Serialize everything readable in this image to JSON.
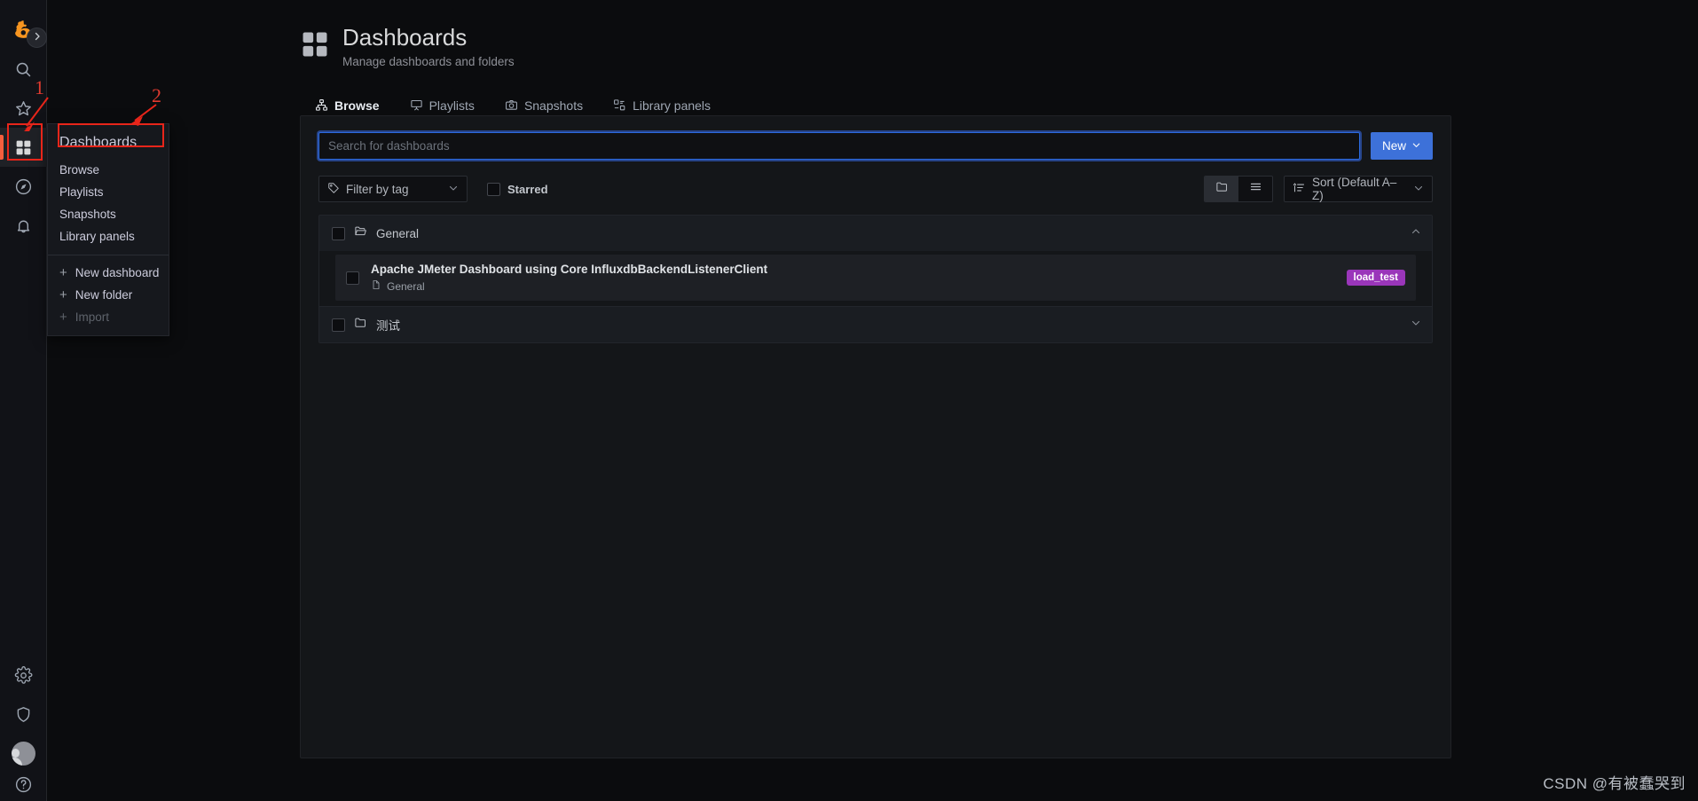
{
  "nav_rail": {
    "expand_button": {
      "icon": "chevron-right-icon"
    },
    "top_items": [
      {
        "name": "grafana-logo",
        "icon": "grafana-logo-icon",
        "label": "Grafana"
      },
      {
        "name": "search",
        "icon": "search-icon",
        "label": "Search"
      },
      {
        "name": "starred",
        "icon": "star-icon",
        "label": "Starred"
      },
      {
        "name": "dashboards",
        "icon": "apps-grid-icon",
        "label": "Dashboards",
        "active": true
      },
      {
        "name": "explore",
        "icon": "compass-icon",
        "label": "Explore"
      },
      {
        "name": "alerting",
        "icon": "bell-icon",
        "label": "Alerting"
      }
    ],
    "bottom_items": [
      {
        "name": "configuration",
        "icon": "gear-icon",
        "label": "Configuration"
      },
      {
        "name": "server-admin",
        "icon": "shield-icon",
        "label": "Server Admin"
      },
      {
        "name": "profile",
        "icon": "avatar-icon",
        "label": "Profile"
      },
      {
        "name": "help",
        "icon": "question-circle-icon",
        "label": "Help"
      }
    ]
  },
  "nav_dropdown": {
    "section_title": "Dashboards",
    "items": [
      {
        "label": "Browse"
      },
      {
        "label": "Playlists"
      },
      {
        "label": "Snapshots"
      },
      {
        "label": "Library panels"
      }
    ],
    "actions": [
      {
        "label": "New dashboard",
        "icon": "plus-icon",
        "plus": "+",
        "dim": false
      },
      {
        "label": "New folder",
        "icon": "plus-icon",
        "plus": "+",
        "dim": false
      },
      {
        "label": "Import",
        "icon": "plus-icon",
        "plus": "+",
        "dim": true
      }
    ]
  },
  "header": {
    "icon": "apps-grid-icon",
    "title": "Dashboards",
    "subtitle": "Manage dashboards and folders"
  },
  "tabs": [
    {
      "label": "Browse",
      "icon": "sitemap-icon",
      "active": true
    },
    {
      "label": "Playlists",
      "icon": "presentation-icon",
      "active": false
    },
    {
      "label": "Snapshots",
      "icon": "camera-icon",
      "active": false
    },
    {
      "label": "Library panels",
      "icon": "library-panel-icon",
      "active": false
    }
  ],
  "search": {
    "placeholder": "Search for dashboards",
    "value": "",
    "new_button_label": "New",
    "new_button_chevron": "⌄"
  },
  "filters": {
    "tag_filter_label": "Filter by tag",
    "tag_filter_icon": "tag-icon",
    "starred_label": "Starred",
    "starred_checked": false,
    "view_folder_icon": "folder-icon",
    "view_list_icon": "list-icon",
    "view_mode": "folder",
    "sort_label": "Sort (Default A–Z)",
    "sort_icon": "sort-amount-up-icon"
  },
  "results": {
    "folders": [
      {
        "name": "General",
        "icon": "folder-open-icon",
        "expanded": true,
        "chevron": "chevron-up-icon",
        "checked": false,
        "dashboards": [
          {
            "title": "Apache JMeter Dashboard using Core InfluxdbBackendListenerClient",
            "folder": "General",
            "folder_icon": "file-icon",
            "tags": [
              "load_test"
            ],
            "checked": false
          }
        ]
      },
      {
        "name": "测试",
        "icon": "folder-icon",
        "expanded": false,
        "chevron": "chevron-down-icon",
        "checked": false,
        "dashboards": []
      }
    ]
  },
  "annotations": [
    {
      "id": "1",
      "label": "1",
      "target": "dashboards-rail-icon"
    },
    {
      "id": "2",
      "label": "2",
      "target": "dashboards-menu-title"
    }
  ],
  "watermark": "CSDN @有被蠢哭到",
  "colors": {
    "accent_orange": "#f55f3e",
    "primary_blue": "#3d71d9",
    "tag_purple": "#9a36ba",
    "annotation_red": "#e8251a",
    "panel_bg": "#141619",
    "rail_bg": "#111217"
  }
}
